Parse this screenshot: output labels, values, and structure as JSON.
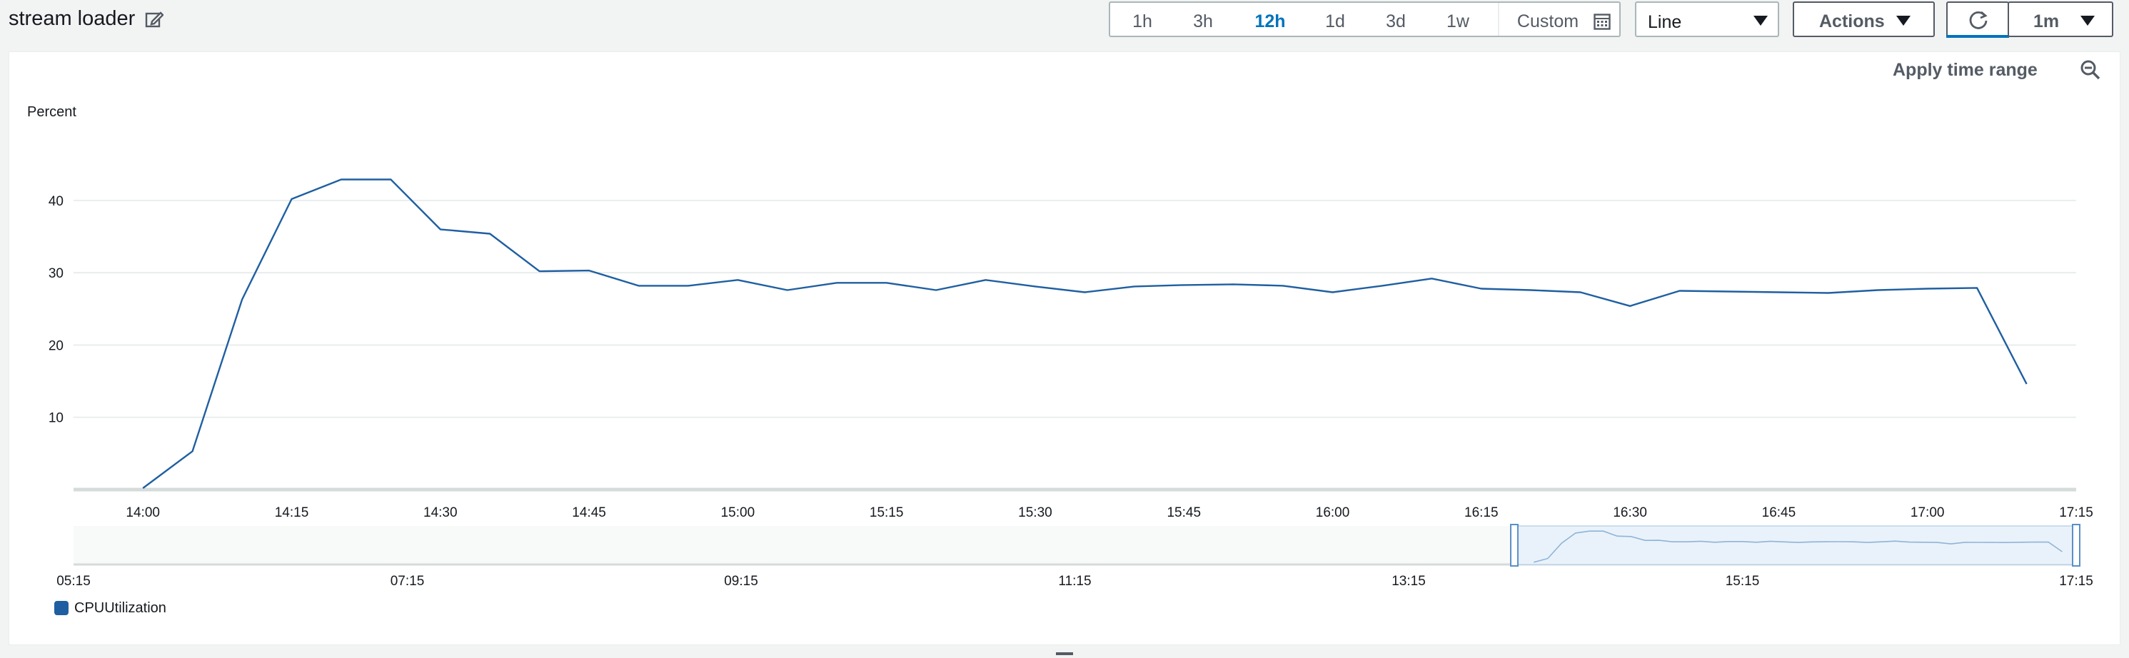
{
  "header": {
    "title": "stream loader",
    "time_ranges": [
      "1h",
      "3h",
      "12h",
      "1d",
      "3d",
      "1w"
    ],
    "active_range": "12h",
    "custom_label": "Custom",
    "view_type": "Line",
    "actions_label": "Actions",
    "refresh_interval": "1m"
  },
  "panel": {
    "apply_time_range_label": "Apply time range"
  },
  "chart_data": {
    "type": "line",
    "ylabel": "Percent",
    "ylim": [
      0,
      47
    ],
    "y_ticks": [
      10,
      20,
      30,
      40
    ],
    "x_ticks": [
      "14:00",
      "14:15",
      "14:30",
      "14:45",
      "15:00",
      "15:15",
      "15:30",
      "15:45",
      "16:00",
      "16:15",
      "16:30",
      "16:45",
      "17:00",
      "17:15"
    ],
    "x_range": [
      "13:53",
      "17:15"
    ],
    "grid": true,
    "series": [
      {
        "name": "CPUUtilization",
        "color": "#1f5fa1",
        "x": [
          "14:00",
          "14:05",
          "14:10",
          "14:15",
          "14:20",
          "14:25",
          "14:30",
          "14:35",
          "14:40",
          "14:45",
          "14:50",
          "14:55",
          "15:00",
          "15:05",
          "15:10",
          "15:15",
          "15:20",
          "15:25",
          "15:30",
          "15:35",
          "15:40",
          "15:45",
          "15:50",
          "15:55",
          "16:00",
          "16:05",
          "16:10",
          "16:15",
          "16:20",
          "16:25",
          "16:30",
          "16:35",
          "16:40",
          "16:45",
          "16:50",
          "16:55",
          "17:00",
          "17:05",
          "17:10"
        ],
        "values": [
          0.2,
          5.3,
          26.3,
          40.2,
          42.9,
          42.9,
          36.0,
          35.4,
          30.2,
          30.3,
          28.2,
          28.2,
          29.0,
          27.6,
          28.6,
          28.6,
          27.6,
          29.0,
          28.1,
          27.3,
          28.1,
          28.3,
          28.4,
          28.2,
          27.3,
          28.2,
          29.2,
          27.8,
          27.6,
          27.3,
          25.4,
          27.5,
          27.4,
          27.3,
          27.2,
          27.6,
          27.8,
          27.9,
          14.6
        ]
      }
    ],
    "overview": {
      "x_ticks": [
        "05:15",
        "07:15",
        "09:15",
        "11:15",
        "13:15",
        "15:15",
        "17:15"
      ],
      "selection": [
        "13:53",
        "17:15"
      ]
    },
    "legend": [
      "CPUUtilization"
    ]
  }
}
